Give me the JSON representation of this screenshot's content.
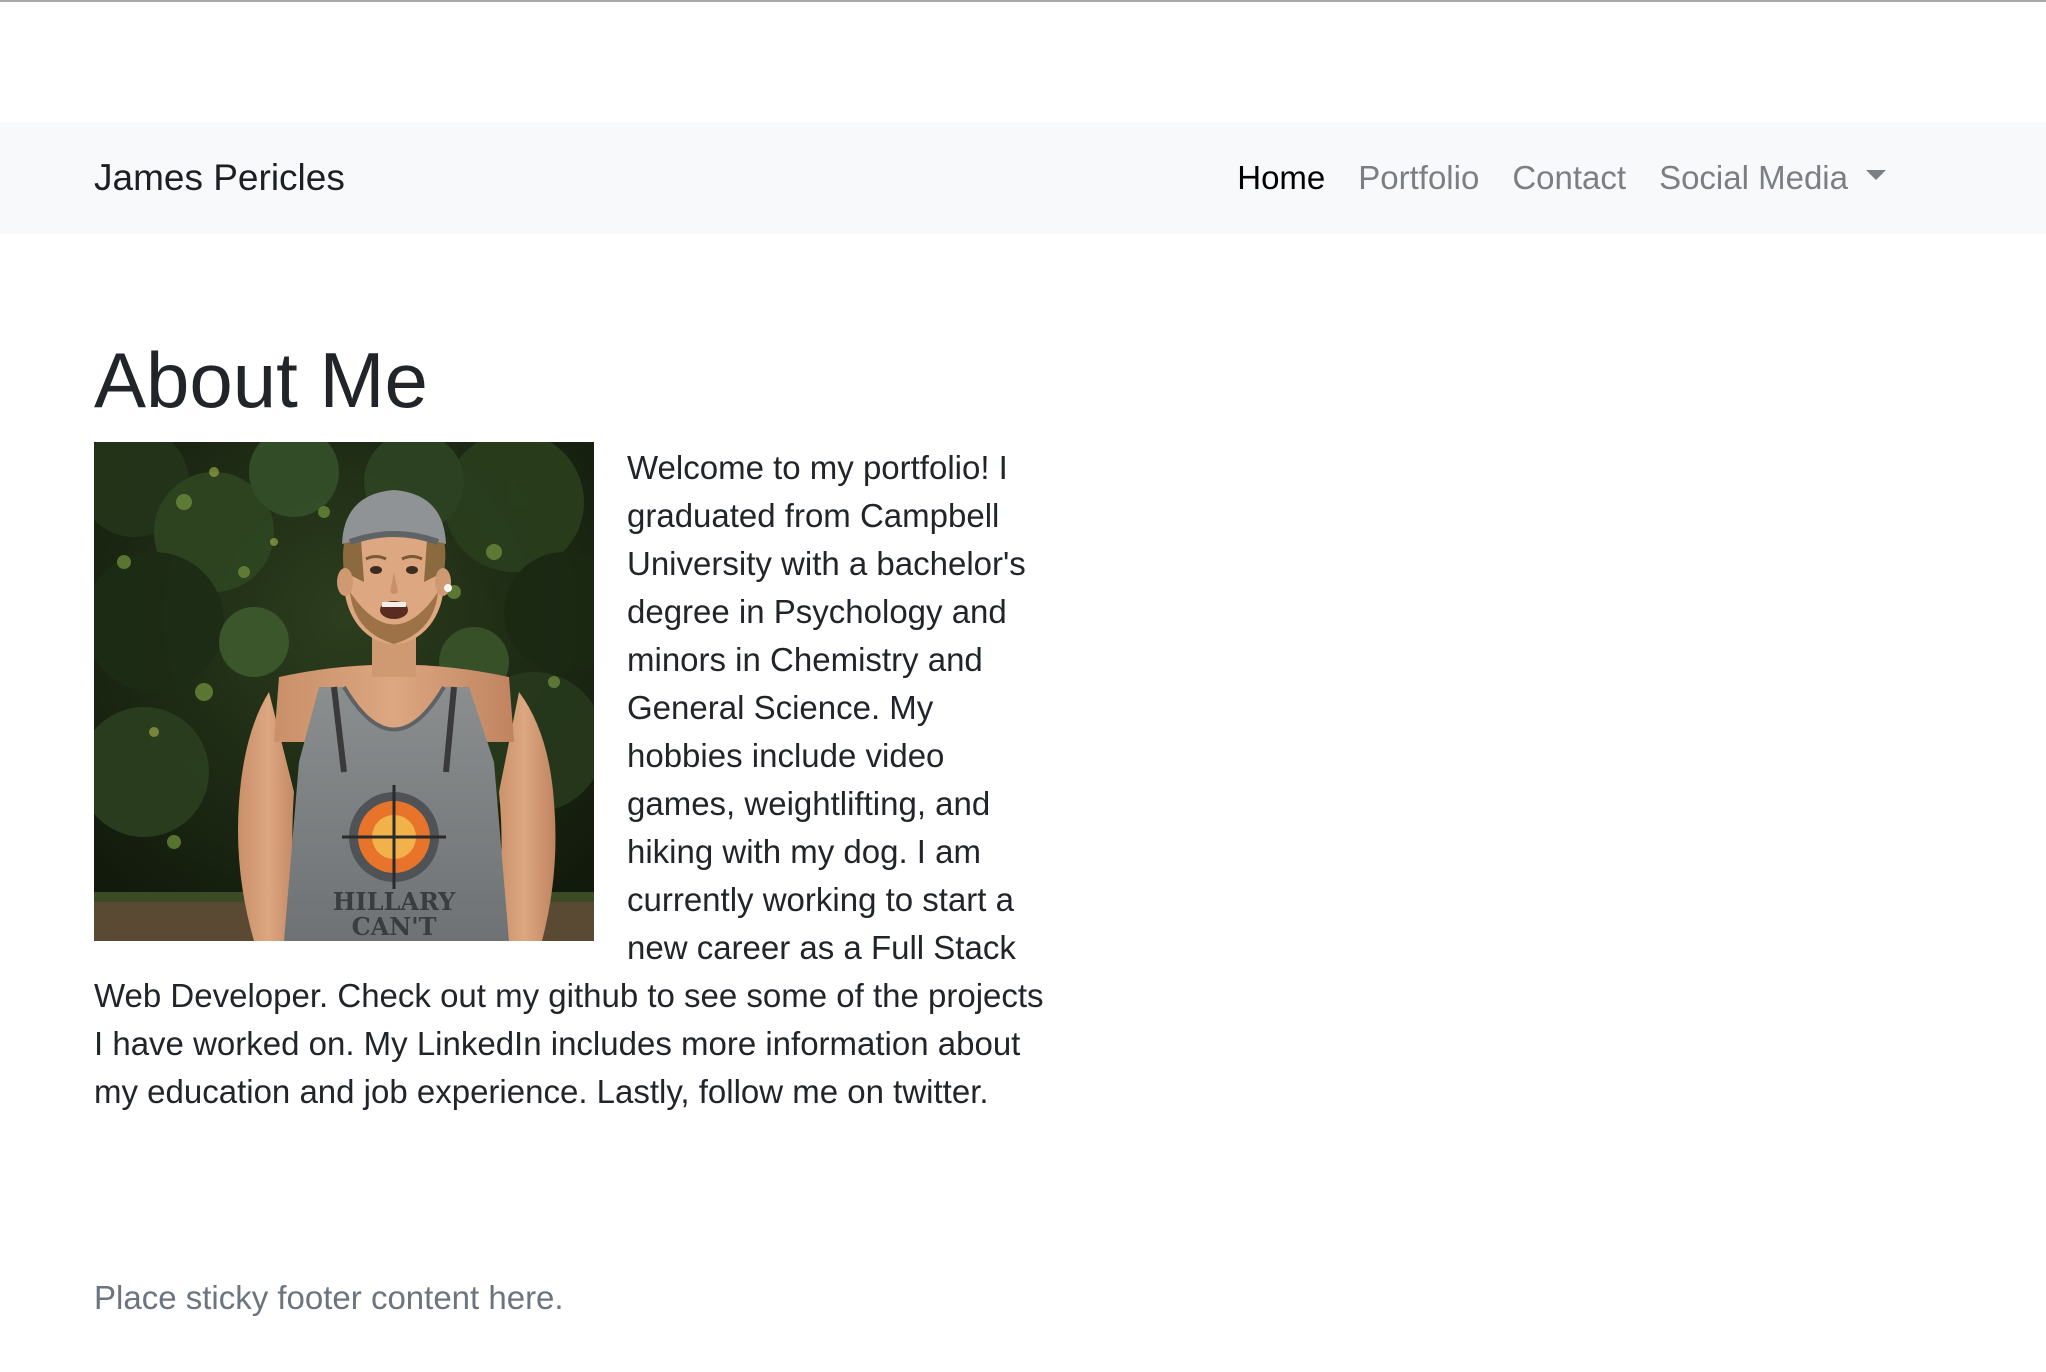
{
  "navbar": {
    "brand": "James Pericles",
    "links": [
      {
        "label": "Home",
        "active": true
      },
      {
        "label": "Portfolio",
        "active": false
      },
      {
        "label": "Contact",
        "active": false
      },
      {
        "label": "Social Media",
        "active": false,
        "dropdown": true
      }
    ]
  },
  "main": {
    "heading": "About Me",
    "photo_icon": "profile-photo",
    "photo_shirt_text": "HILLARY CAN'T",
    "bio": "Welcome to my portfolio! I graduated from Campbell University with a bachelor's degree in Psychology and minors in Chemistry and General Science. My hobbies include video games, weightlifting, and hiking with my dog. I am currently working to start a new career as a Full Stack Web Developer. Check out my github to see some of the projects I have worked on. My LinkedIn includes more information about my education and job experience. Lastly, follow me on twitter."
  },
  "footer": {
    "text": "Place sticky footer content here."
  },
  "colors": {
    "navbar_bg": "#f8f9fa",
    "text": "#212529",
    "muted": "#6c757d",
    "nav_inactive": "#7b7f84"
  }
}
